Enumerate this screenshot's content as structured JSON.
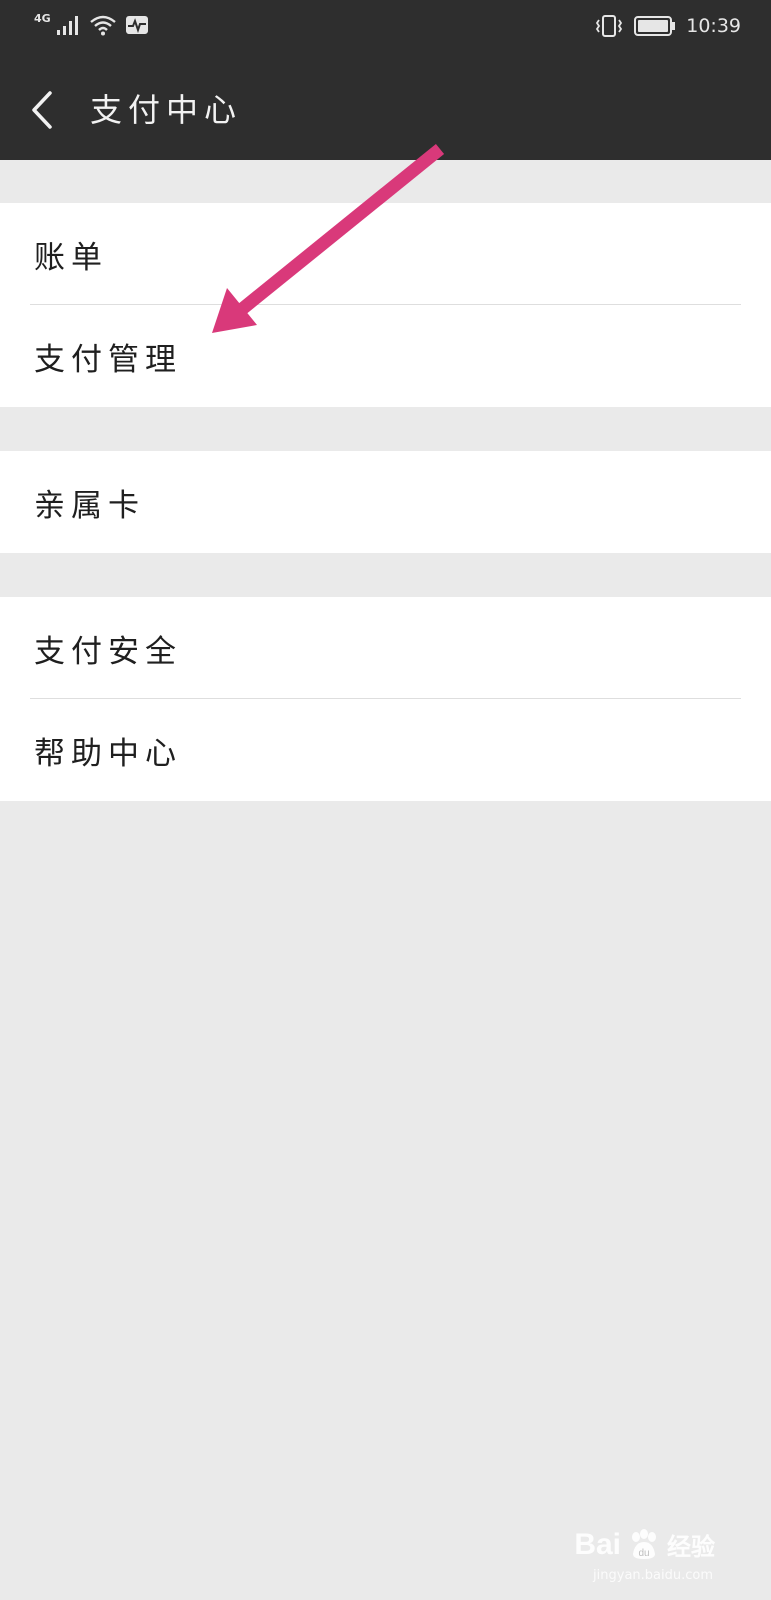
{
  "status_bar": {
    "network": "4G",
    "time": "10:39"
  },
  "app_bar": {
    "title": "支付中心"
  },
  "menu_groups": [
    {
      "items": [
        {
          "label": "账单"
        },
        {
          "label": "支付管理"
        }
      ]
    },
    {
      "items": [
        {
          "label": "亲属卡"
        }
      ]
    },
    {
      "items": [
        {
          "label": "支付安全"
        },
        {
          "label": "帮助中心"
        }
      ]
    }
  ],
  "annotation": {
    "arrow_color": "#d9397a"
  },
  "watermark": {
    "brand": "Bai",
    "brand_mid": "du",
    "brand_cn": "经验",
    "url": "jingyan.baidu.com"
  }
}
